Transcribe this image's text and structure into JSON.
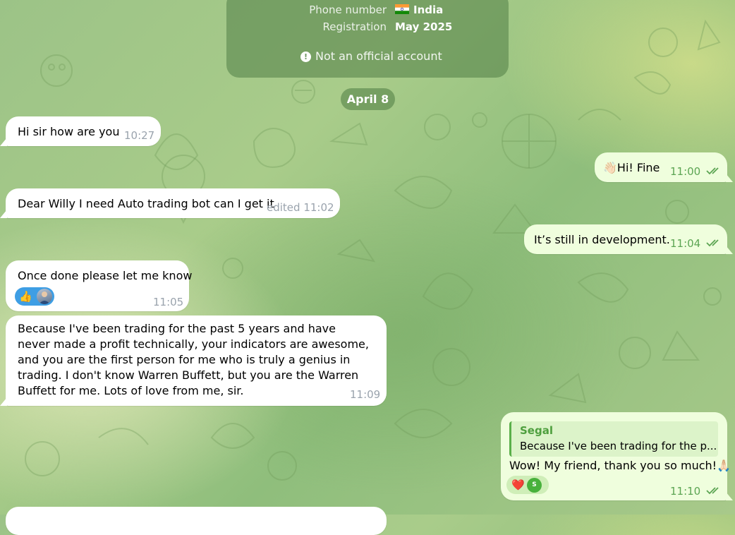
{
  "account_info": {
    "phone_label": "Phone number",
    "phone_country": "India",
    "registration_label": "Registration",
    "registration_value": "May 2025",
    "notice": "Not an official account",
    "notice_icon": "exclamation-circle-icon"
  },
  "date_separator": "April 8",
  "messages": [
    {
      "direction": "incoming",
      "text": "Hi sir how are you",
      "time": "10:27"
    },
    {
      "direction": "outgoing",
      "emoji": "👋🏻",
      "text": "Hi! Fine",
      "time": "11:00",
      "status": "read"
    },
    {
      "direction": "incoming",
      "text": "Dear Willy I need Auto trading bot can I get it",
      "time": "edited 11:02"
    },
    {
      "direction": "outgoing",
      "text": "It’s still in development.",
      "time": "11:04",
      "status": "read"
    },
    {
      "direction": "incoming",
      "text": "Once done please let me know",
      "time": "11:05",
      "reactions": [
        "👍"
      ]
    },
    {
      "direction": "incoming",
      "text": "Because I've been trading for the past 5 years and have never made a profit technically, your indicators are awesome, and you are the first person for me who is truly a genius in trading. I don't know Warren Buffett, but you are the Warren Buffett for me. Lots of love from me, sir.",
      "time": "11:09"
    },
    {
      "direction": "outgoing",
      "reply_to": {
        "name": "Segal",
        "text": "Because I've been trading for the p..."
      },
      "text": "Wow! My friend, thank you so much!",
      "emoji": "🙏🏻",
      "time": "11:10",
      "status": "read",
      "reactions": [
        "❤️"
      ],
      "reaction_user_initial": "S"
    }
  ],
  "colors": {
    "incoming_bubble": "#ffffff",
    "outgoing_bubble": "#effedd",
    "outgoing_time": "#5ca553",
    "reaction_blue": "#3e9ee4",
    "reply_accent": "#4e9f3e",
    "background_green": "#9cc387"
  }
}
